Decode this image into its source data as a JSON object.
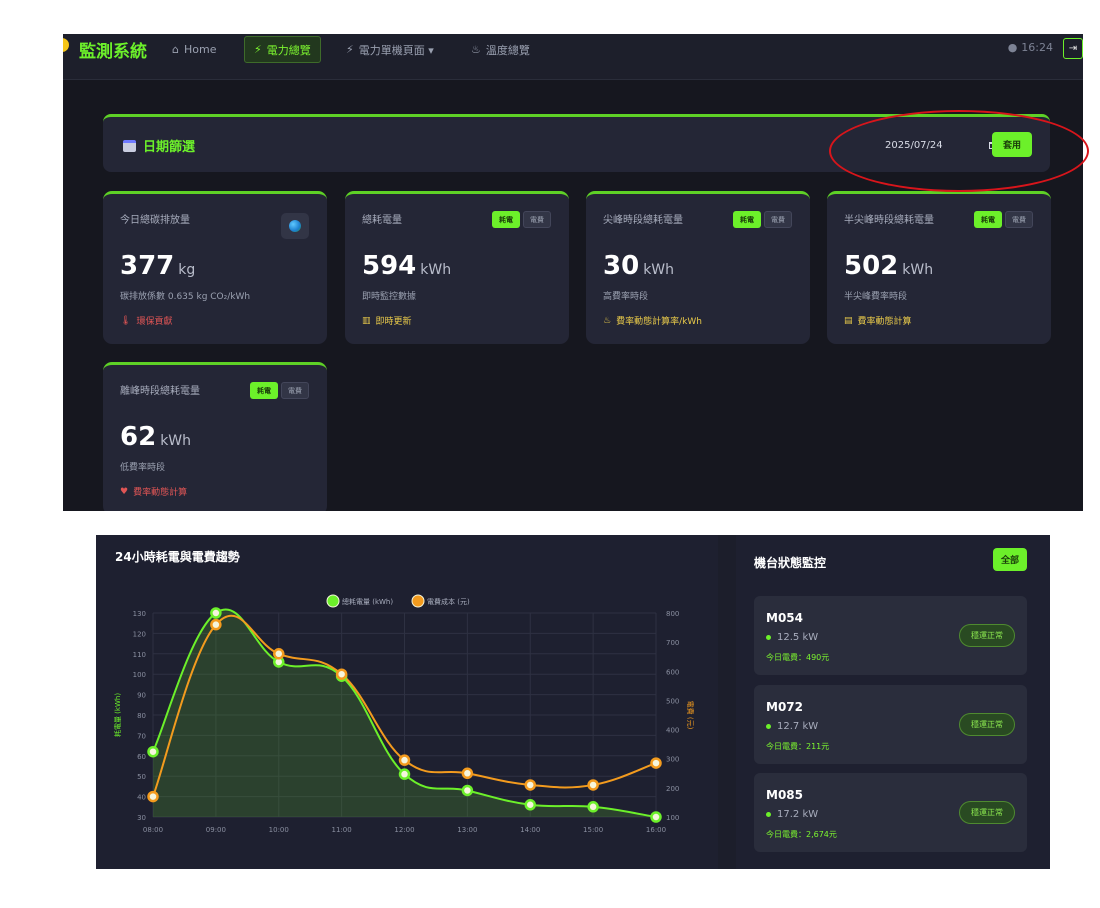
{
  "navbar": {
    "brand": "監測系統",
    "items": [
      {
        "icon": "home-icon",
        "glyph": "⌂",
        "label": "Home"
      },
      {
        "icon": "plug-icon",
        "glyph": "⚡",
        "label": "電力總覽"
      },
      {
        "icon": "plug-icon",
        "glyph": "⚡",
        "label": "電力單機頁面 ▾"
      },
      {
        "icon": "flame-icon",
        "glyph": "♨",
        "label": "溫度總覽"
      }
    ],
    "time": "16:24",
    "logout_glyph": "⇥"
  },
  "filter": {
    "title": "日期篩選",
    "date_value": "2025/07/24",
    "apply_label": "套用"
  },
  "cards": [
    {
      "title": "今日總碳排放量",
      "value": "377",
      "unit": "kg",
      "sub": "碳排放係數 0.635 kg CO₂/kWh",
      "foot_icon": "thermometer-icon",
      "foot_glyph": "🌡",
      "foot": "環保貢獻",
      "foot_color": "#e05555",
      "toggle": null
    },
    {
      "title": "總耗電量",
      "value": "594",
      "unit": "kWh",
      "sub": "即時監控數據",
      "foot_icon": "chart-icon",
      "foot_glyph": "▥",
      "foot": "即時更新",
      "foot_color": "#e8c94a",
      "toggle": [
        "耗電",
        "電費"
      ]
    },
    {
      "title": "尖峰時段總耗電量",
      "value": "30",
      "unit": "kWh",
      "sub": "高費率時段",
      "foot_icon": "flame-icon",
      "foot_glyph": "♨",
      "foot": "費率動態計算率/kWh",
      "foot_color": "#e8c94a",
      "toggle": [
        "耗電",
        "電費"
      ]
    },
    {
      "title": "半尖峰時段總耗電量",
      "value": "502",
      "unit": "kWh",
      "sub": "半尖峰費率時段",
      "foot_icon": "chart-icon",
      "foot_glyph": "▤",
      "foot": "費率動態計算",
      "foot_color": "#e8c94a",
      "toggle": [
        "耗電",
        "電費"
      ]
    },
    {
      "title": "離峰時段總耗電量",
      "value": "62",
      "unit": "kWh",
      "sub": "低費率時段",
      "foot_icon": "heart-icon",
      "foot_glyph": "♥",
      "foot": "費率動態計算",
      "foot_color": "#e05555",
      "toggle": [
        "耗電",
        "電費"
      ]
    }
  ],
  "chart_panel": {
    "title": "24小時耗電與電費趨勢"
  },
  "chart_data": {
    "type": "line",
    "title": "24小時耗電與電費趨勢",
    "x": [
      "08:00",
      "09:00",
      "10:00",
      "11:00",
      "12:00",
      "13:00",
      "14:00",
      "15:00",
      "16:00"
    ],
    "ylabel": "耗電量 (kWh)",
    "y2label": "電費 (元)",
    "ylim": [
      30,
      130
    ],
    "y2lim": [
      100,
      800
    ],
    "yticks": [
      30,
      40,
      50,
      60,
      70,
      80,
      90,
      100,
      110,
      120,
      130
    ],
    "y2ticks": [
      100,
      200,
      300,
      400,
      500,
      600,
      700,
      800
    ],
    "legend_position": "top-center",
    "grid": true,
    "series": [
      {
        "name": "總耗電量 (kWh)",
        "axis": "left",
        "color": "#6cf02a",
        "fill": true,
        "values": [
          62,
          130,
          106,
          99,
          51,
          43,
          36,
          35,
          30
        ]
      },
      {
        "name": "電費成本 (元)",
        "axis": "right",
        "color": "#f39b1e",
        "fill": false,
        "values": [
          170,
          760,
          660,
          590,
          295,
          250,
          210,
          210,
          285
        ]
      }
    ]
  },
  "status_panel": {
    "title": "機台狀態監控",
    "all_label": "全部",
    "machines": [
      {
        "id": "M054",
        "power": "12.5 kW",
        "today": "今日電費：490元",
        "state": "穩運正常"
      },
      {
        "id": "M072",
        "power": "12.7 kW",
        "today": "今日電費：211元",
        "state": "穩運正常"
      },
      {
        "id": "M085",
        "power": "17.2 kW",
        "today": "今日電費：2,674元",
        "state": "穩運正常"
      }
    ]
  }
}
